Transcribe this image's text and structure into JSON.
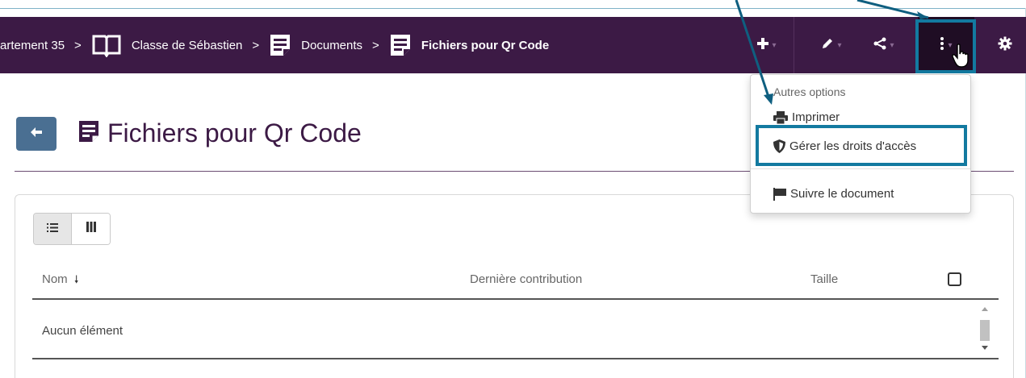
{
  "breadcrumb": {
    "items": [
      {
        "label": "artement 35"
      },
      {
        "label": "Classe de Sébastien"
      },
      {
        "label": "Documents"
      },
      {
        "label": "Fichiers pour Qr Code"
      }
    ],
    "separator": ">"
  },
  "toolbar": {
    "add_icon": "plus-icon",
    "edit_icon": "pencil-icon",
    "share_icon": "share-icon",
    "more_icon": "vertical-ellipsis-icon",
    "settings_icon": "gear-icon"
  },
  "page": {
    "title": "Fichiers pour Qr Code"
  },
  "dropdown": {
    "header": "Autres options",
    "items": [
      {
        "label": "Imprimer",
        "icon": "printer-icon"
      },
      {
        "label": "Gérer les droits d'accès",
        "icon": "shield-icon"
      },
      {
        "label": "Suivre le document",
        "icon": "flag-icon"
      }
    ]
  },
  "table": {
    "columns": [
      "Nom",
      "Dernière contribution",
      "Taille"
    ],
    "sort_indicator": "🠗",
    "empty_text": "Aucun élément"
  },
  "colors": {
    "navbar": "#3c1a45",
    "highlight": "#137aa0",
    "back_button": "#4a6f92"
  }
}
